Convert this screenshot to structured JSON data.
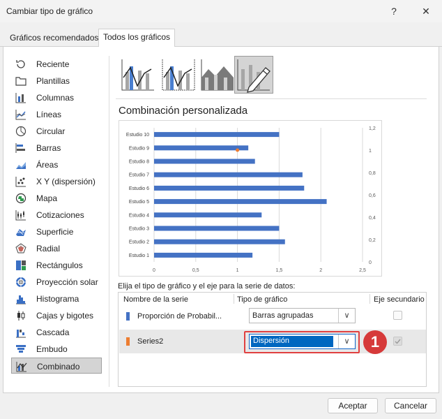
{
  "window": {
    "title": "Cambiar tipo de gráfico",
    "help": "?",
    "close": "✕"
  },
  "tabs": [
    {
      "label": "Gráficos recomendados"
    },
    {
      "label": "Todos los gráficos"
    }
  ],
  "sidebar": {
    "items": [
      {
        "label": "Reciente",
        "icon": "recent-icon"
      },
      {
        "label": "Plantillas",
        "icon": "folder-icon"
      },
      {
        "label": "Columnas",
        "icon": "column-chart-icon"
      },
      {
        "label": "Líneas",
        "icon": "line-chart-icon"
      },
      {
        "label": "Circular",
        "icon": "pie-chart-icon"
      },
      {
        "label": "Barras",
        "icon": "bar-chart-icon"
      },
      {
        "label": "Áreas",
        "icon": "area-chart-icon"
      },
      {
        "label": "X Y (dispersión)",
        "icon": "scatter-chart-icon"
      },
      {
        "label": "Mapa",
        "icon": "map-chart-icon"
      },
      {
        "label": "Cotizaciones",
        "icon": "stock-chart-icon"
      },
      {
        "label": "Superficie",
        "icon": "surface-chart-icon"
      },
      {
        "label": "Radial",
        "icon": "radar-chart-icon"
      },
      {
        "label": "Rectángulos",
        "icon": "treemap-chart-icon"
      },
      {
        "label": "Proyección solar",
        "icon": "sunburst-chart-icon"
      },
      {
        "label": "Histograma",
        "icon": "histogram-chart-icon"
      },
      {
        "label": "Cajas y bigotes",
        "icon": "box-whisker-chart-icon"
      },
      {
        "label": "Cascada",
        "icon": "waterfall-chart-icon"
      },
      {
        "label": "Embudo",
        "icon": "funnel-chart-icon"
      },
      {
        "label": "Combinado",
        "icon": "combo-chart-icon",
        "selected": true
      }
    ]
  },
  "subtypes": [
    {
      "icon": "combo-column-line-icon"
    },
    {
      "icon": "combo-column-line-secondary-icon"
    },
    {
      "icon": "combo-area-column-icon"
    },
    {
      "icon": "custom-combo-icon",
      "selected": true
    }
  ],
  "heading": "Combinación personalizada",
  "chart_data": {
    "type": "bar",
    "categories": [
      "Estudio 1",
      "Estudio 2",
      "Estudio 3",
      "Estudio 4",
      "Estudio 5",
      "Estudio 6",
      "Estudio 7",
      "Estudio 8",
      "Estudio 9",
      "Estudio 10"
    ],
    "series": [
      {
        "name": "Proporción de Probabil...",
        "type": "bar",
        "color": "#4472c4",
        "values": [
          1.18,
          1.57,
          1.5,
          1.29,
          2.07,
          1.8,
          1.78,
          1.21,
          1.13,
          1.5
        ]
      },
      {
        "name": "Series2",
        "type": "scatter",
        "color": "#ed7d31",
        "points": [
          {
            "x": 1.0,
            "y": 1.0
          }
        ]
      }
    ],
    "x_ticks": [
      "0",
      "0,5",
      "1",
      "1,5",
      "2",
      "2,5"
    ],
    "xlim": [
      0,
      2.5
    ],
    "y2_ticks": [
      "0",
      "0,2",
      "0,4",
      "0,6",
      "0,8",
      "1",
      "1,2"
    ],
    "y2lim": [
      0,
      1.2
    ],
    "grid": "vertical",
    "title": "",
    "xlabel": "",
    "ylabel": ""
  },
  "series_panel": {
    "instruction": "Elija el tipo de gráfico y el eje para la serie de datos:",
    "headers": {
      "name": "Nombre de la serie",
      "type": "Tipo de gráfico",
      "secondary": "Eje secundario"
    },
    "rows": [
      {
        "name": "Proporción de Probabil...",
        "color": "#4472c4",
        "chart_type": "Barras agrupadas",
        "secondary": false
      },
      {
        "name": "Series2",
        "color": "#ed7d31",
        "chart_type": "Dispersión",
        "secondary": true
      }
    ]
  },
  "callout": "1",
  "buttons": {
    "ok": "Aceptar",
    "cancel": "Cancelar"
  }
}
